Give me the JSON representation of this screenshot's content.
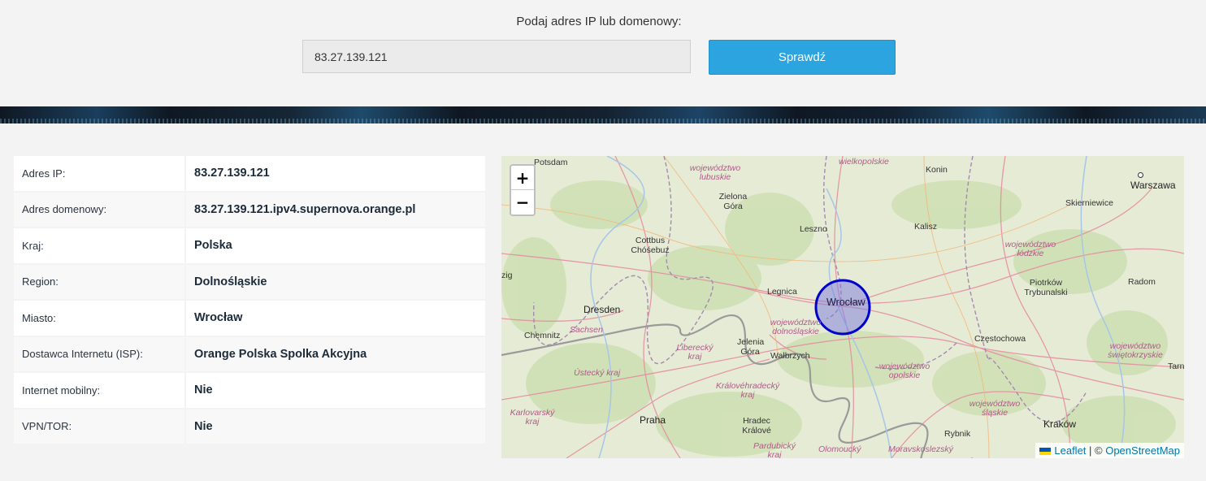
{
  "search": {
    "label": "Podaj adres IP lub domenowy:",
    "value": "83.27.139.121",
    "button_label": "Sprawdź"
  },
  "info": {
    "rows": [
      {
        "key": "Adres IP:",
        "value": "83.27.139.121"
      },
      {
        "key": "Adres domenowy:",
        "value": "83.27.139.121.ipv4.supernova.orange.pl"
      },
      {
        "key": "Kraj:",
        "value": "Polska"
      },
      {
        "key": "Region:",
        "value": "Dolnośląskie"
      },
      {
        "key": "Miasto:",
        "value": "Wrocław"
      },
      {
        "key": "Dostawca Internetu (ISP):",
        "value": "Orange Polska Spolka Akcyjna"
      },
      {
        "key": "Internet mobilny:",
        "value": "Nie"
      },
      {
        "key": "VPN/TOR:",
        "value": "Nie"
      }
    ]
  },
  "map": {
    "zoom_in": "+",
    "zoom_out": "−",
    "attribution": {
      "leaflet": "Leaflet",
      "separator": " | © ",
      "osm": "OpenStreetMap"
    },
    "marker_city": "Wrocław",
    "labels": {
      "potsdam": "Potsdam",
      "lubuskie": "województwo lubuskie",
      "zielona_gora": "Zielona Góra",
      "wielkopolskie": "wielkopolskie",
      "konin": "Konin",
      "warszawa": "Warszawa",
      "skierniewice": "Skierniewice",
      "leszno": "Leszno",
      "kalisz": "Kalisz",
      "lodzkie": "województwo łódzkie",
      "cottbus": "Cottbus Chóśebuz",
      "zig": "zig",
      "legnica": "Legnica",
      "piotrkow": "Piotrków Trybunalski",
      "radom": "Radom",
      "dresden": "Dresden",
      "dolnoslaskie": "województwo dolnośląskie",
      "chemnitz": "Chemnitz",
      "sachsen": "Sachsen",
      "liberecky": "Liberecký kraj",
      "jelenia_gora": "Jelenia Góra",
      "walbrzych": "Wałbrzych",
      "czestochowa": "Częstochowa",
      "swietokrzyskie": "województwo świętokrzyskie",
      "ustecky": "Ústecký kraj",
      "opolskie": "województwo opolskie",
      "tarn": "Tarn",
      "kralovehradecky": "Královéhradecký kraj",
      "karlovarsky": "Karlovarský kraj",
      "praha": "Praha",
      "hradec": "Hradec Králové",
      "slaskie": "województwo śląskie",
      "rybnik": "Rybnik",
      "krakow": "Kraków",
      "pardubicky": "Pardubický kraj",
      "olomoucky": "Olomoucký",
      "moravskoslezsky": "Moravskoslezský"
    }
  },
  "colors": {
    "button": "#2ba4e0",
    "marker_stroke": "#0000cc",
    "marker_fill": "#7a7ae0",
    "map_land": "#e6ebd5",
    "link": "#0078a8"
  }
}
